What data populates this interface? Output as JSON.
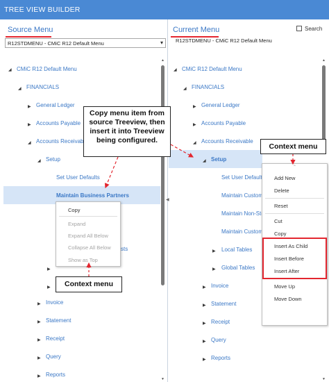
{
  "app": {
    "title": "TREE VIEW BUILDER"
  },
  "source": {
    "title": "Source Menu",
    "select_value": "R12STDMENU - CMiC R12 Default Menu",
    "tree": {
      "root": "CMiC R12 Default Menu",
      "financials": "FINANCIALS",
      "general_ledger": "General Ledger",
      "accounts_payable": "Accounts Payable",
      "accounts_receivable": "Accounts Receivable",
      "setup": "Setup",
      "set_user_defaults": "Set User Defaults",
      "maintain_business_partners": "Maintain Business Partners",
      "partial_sts": "sts",
      "invoice": "Invoice",
      "statement": "Statement",
      "receipt": "Receipt",
      "query": "Query",
      "reports": "Reports"
    },
    "context_menu": {
      "copy": "Copy",
      "expand": "Expand",
      "expand_all_below": "Expand All Below",
      "collapse_all_below": "Collapse All Below",
      "show_as_top": "Show as Top"
    }
  },
  "current": {
    "title": "Current Menu",
    "search_label": "Search",
    "menu_value": "R12STDMENU - CMiC R12 Default Menu",
    "tree": {
      "root": "CMiC R12 Default Menu",
      "financials": "FINANCIALS",
      "general_ledger": "General Ledger",
      "accounts_payable": "Accounts Payable",
      "accounts_receivable": "Accounts Receivable",
      "setup": "Setup",
      "set_user_defaults": "Set User Defaults",
      "maintain_custom_1": "Maintain Custom",
      "maintain_non_sto": "Maintain Non-Sto",
      "maintain_custom_2": "Maintain Custom",
      "local_tables": "Local Tables",
      "global_tables": "Global Tables",
      "invoice": "Invoice",
      "statement": "Statement",
      "receipt": "Receipt",
      "query": "Query",
      "reports": "Reports"
    },
    "context_menu": {
      "add_new": "Add New",
      "delete": "Delete",
      "reset": "Reset",
      "cut": "Cut",
      "copy": "Copy",
      "insert_as_child": "Insert As Child",
      "insert_before": "Insert Before",
      "insert_after": "Insert After",
      "move_up": "Move Up",
      "move_down": "Move Down"
    }
  },
  "annotations": {
    "instruction": "Copy menu item from source Treeview, then insert it into Treeview being configured.",
    "context_menu_left": "Context menu",
    "context_menu_right": "Context menu"
  },
  "colors": {
    "titlebar": "#4a89d4",
    "link": "#3b78c6",
    "highlight": "#d6e5f7",
    "accent_red": "#e3262f"
  }
}
